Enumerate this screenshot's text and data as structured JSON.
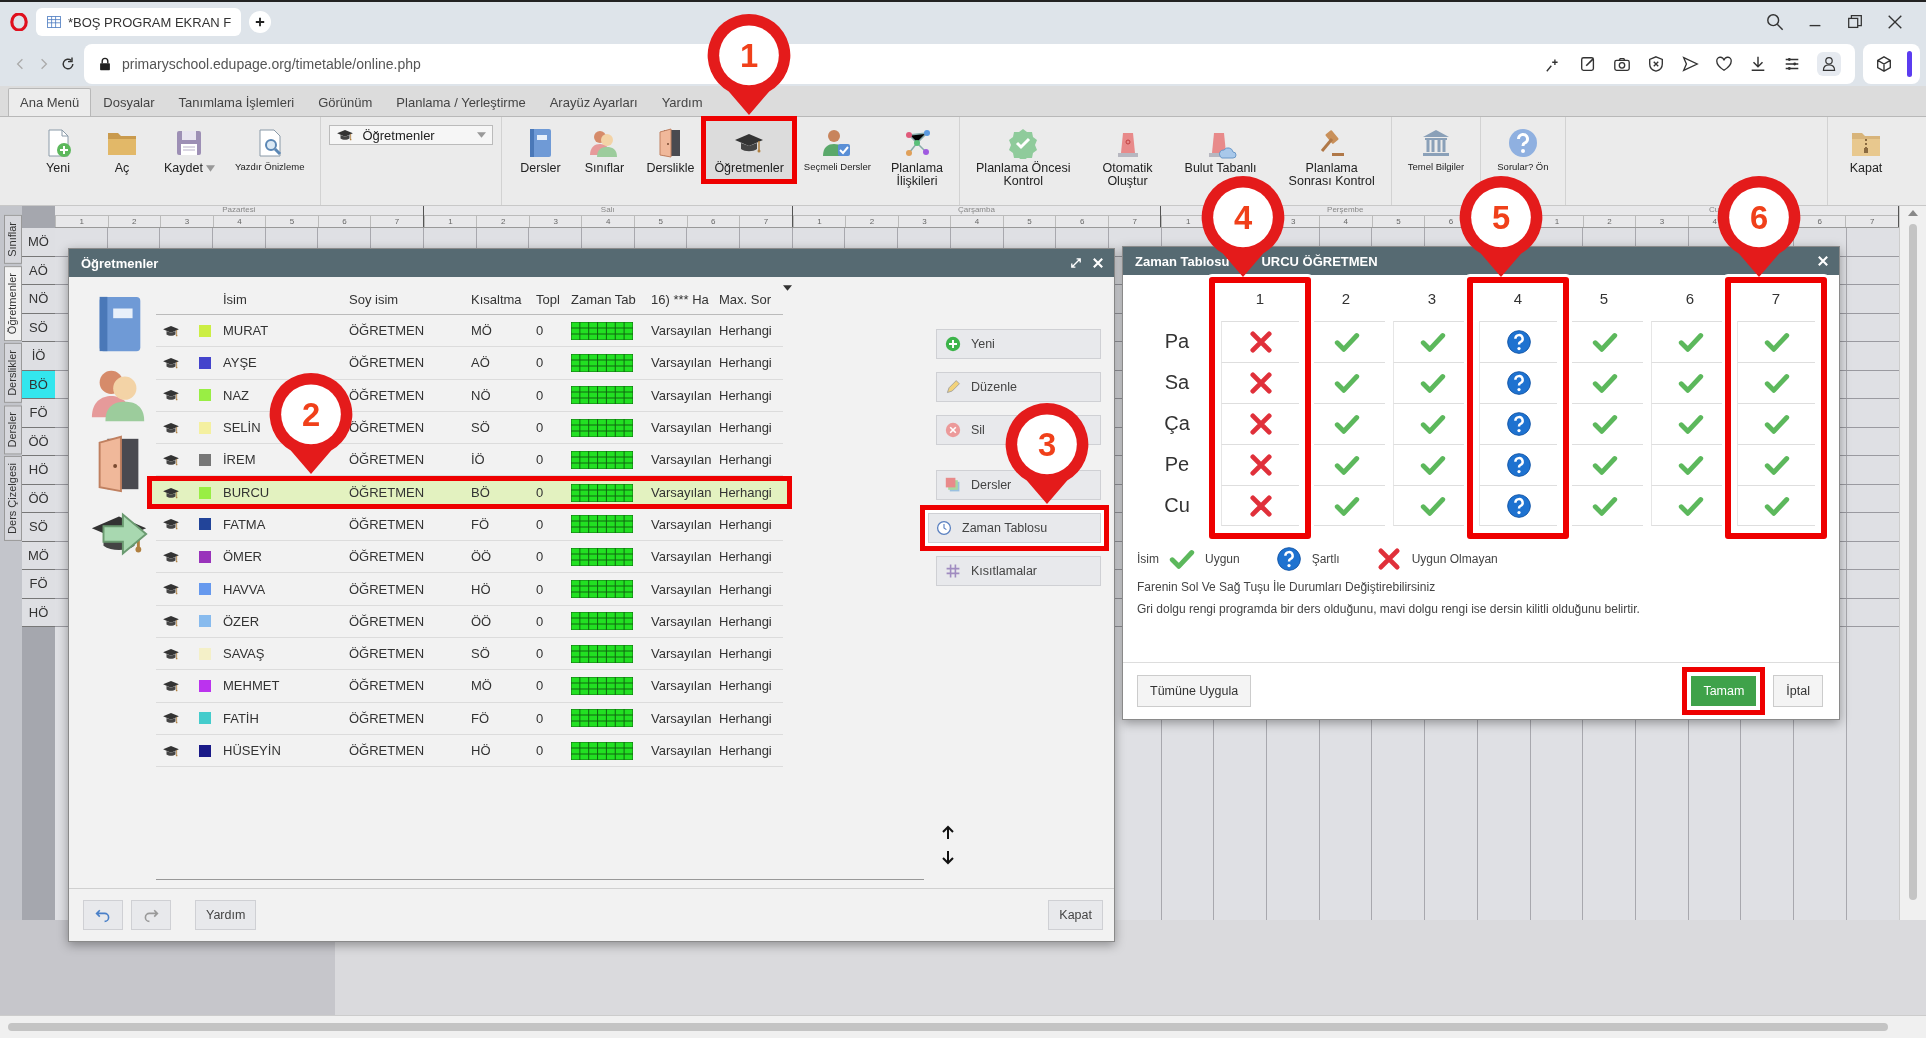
{
  "browser": {
    "tab_title": "*BOŞ PROGRAM EKRAN F",
    "url": "primaryschool.edupage.org/timetable/online.php"
  },
  "menu_tabs": [
    {
      "label": "Ana Menü",
      "selected": true
    },
    {
      "label": "Dosyalar",
      "selected": false
    },
    {
      "label": "Tanımlama İşlemleri",
      "selected": false
    },
    {
      "label": "Görünüm",
      "selected": false
    },
    {
      "label": "Planlama / Yerleştirme",
      "selected": false
    },
    {
      "label": "Arayüz Ayarları",
      "selected": false
    },
    {
      "label": "Yardım",
      "selected": false
    }
  ],
  "ribbon": {
    "groups": [
      {
        "items": [
          {
            "label": "Yeni",
            "kind": "large",
            "highlighted": false
          },
          {
            "label": "Aç",
            "kind": "large",
            "highlighted": false
          },
          {
            "label": "Kaydet",
            "kind": "menu",
            "highlighted": false
          },
          {
            "label": "Yazdır Önizleme",
            "kind": "small",
            "highlighted": false
          }
        ]
      },
      {
        "items": [
          {
            "label": "Öğretmenler",
            "kind": "dropdown",
            "highlighted": false
          }
        ]
      },
      {
        "items": [
          {
            "label": "Dersler",
            "kind": "large",
            "highlighted": false
          },
          {
            "label": "Sınıflar",
            "kind": "large",
            "highlighted": false
          },
          {
            "label": "Derslikle",
            "kind": "large",
            "highlighted": false
          },
          {
            "label": "Öğretmenler",
            "kind": "large",
            "highlighted": true,
            "callout": "1"
          },
          {
            "label": "Seçmeli Dersler",
            "kind": "small",
            "highlighted": false
          },
          {
            "label": "Planlama\nİlişkileri",
            "kind": "large",
            "highlighted": false
          }
        ]
      },
      {
        "items": [
          {
            "label": "Planlama Öncesi\nKontrol",
            "kind": "large",
            "highlighted": false
          },
          {
            "label": "Otomatik\nOluştur",
            "kind": "large",
            "highlighted": false
          },
          {
            "label": "Bulut Tabanlı",
            "kind": "large",
            "highlighted": false
          },
          {
            "label": "Planlama\nSonrası Kontrol",
            "kind": "large",
            "highlighted": false
          }
        ]
      },
      {
        "items": [
          {
            "label": "Temel Bilgiler",
            "kind": "small",
            "highlighted": false
          }
        ]
      },
      {
        "items": [
          {
            "label": "Sorular? Ön",
            "kind": "small",
            "highlighted": false
          }
        ]
      },
      {
        "items": [
          {
            "label": "Kapat",
            "kind": "large",
            "highlighted": false
          }
        ]
      }
    ]
  },
  "background_timetable": {
    "side_tabs": [
      {
        "label": "Sınıflar",
        "selected": false
      },
      {
        "label": "Öğretmenler",
        "selected": true
      },
      {
        "label": "Derslikler",
        "selected": false
      },
      {
        "label": "Dersler",
        "selected": false
      },
      {
        "label": "Ders Çizelgesi",
        "selected": false
      }
    ],
    "days": [
      {
        "label": "Pazartesi",
        "periods": [
          "1",
          "2",
          "3",
          "4",
          "5",
          "6",
          "7"
        ]
      },
      {
        "label": "Salı",
        "periods": [
          "1",
          "2",
          "3",
          "4",
          "5",
          "6",
          "7"
        ]
      },
      {
        "label": "Çarşamba",
        "periods": [
          "1",
          "2",
          "3",
          "4",
          "5",
          "6",
          "7"
        ]
      },
      {
        "label": "Perşembe",
        "periods": [
          "1",
          "3",
          "4",
          "5",
          "6"
        ]
      },
      {
        "label": "Cu",
        "periods": [
          "1",
          "2",
          "3",
          "4",
          "6",
          "7"
        ]
      }
    ],
    "rows": [
      {
        "label": "MÖ",
        "selected": false
      },
      {
        "label": "AÖ",
        "selected": false
      },
      {
        "label": "NÖ",
        "selected": false
      },
      {
        "label": "SÖ",
        "selected": false
      },
      {
        "label": "İÖ",
        "selected": false
      },
      {
        "label": "BÖ",
        "selected": true
      },
      {
        "label": "FÖ",
        "selected": false
      },
      {
        "label": "ÖÖ",
        "selected": false
      },
      {
        "label": "HÖ",
        "selected": false
      },
      {
        "label": "ÖÖ",
        "selected": false
      },
      {
        "label": "SÖ",
        "selected": false
      },
      {
        "label": "MÖ",
        "selected": false
      },
      {
        "label": "FÖ",
        "selected": false
      },
      {
        "label": "HÖ",
        "selected": false
      }
    ]
  },
  "teachers_dialog": {
    "title": "Öğretmenler",
    "nav": [
      {
        "selected": false
      },
      {
        "selected": false
      },
      {
        "selected": false
      },
      {
        "selected": true
      }
    ],
    "columns": [
      "İsim",
      "Soy isim",
      "Kısaltma",
      "Topl",
      "Zaman Tab",
      "16) *** Ha",
      "Max. Sor"
    ],
    "rows": [
      {
        "name": "MURAT",
        "surname": "ÖĞRETMEN",
        "abbr": "MÖ",
        "total": "0",
        "col_16": "Varsayılan",
        "max": "Herhangi",
        "color": "#ccee44",
        "selected": false,
        "highlighted": false
      },
      {
        "name": "AYŞE",
        "surname": "ÖĞRETMEN",
        "abbr": "AÖ",
        "total": "0",
        "col_16": "Varsayılan",
        "max": "Herhangi",
        "color": "#4444cc",
        "selected": false,
        "highlighted": false
      },
      {
        "name": "NAZ",
        "surname": "ÖĞRETMEN",
        "abbr": "NÖ",
        "total": "0",
        "col_16": "Varsayılan",
        "max": "Herhangi",
        "color": "#99ee44",
        "selected": false,
        "highlighted": false
      },
      {
        "name": "SELİN",
        "surname": "ÖĞRETMEN",
        "abbr": "SÖ",
        "total": "0",
        "col_16": "Varsayılan",
        "max": "Herhangi",
        "color": "#f4f0a0",
        "selected": false,
        "highlighted": false
      },
      {
        "name": "İREM",
        "surname": "ÖĞRETMEN",
        "abbr": "İÖ",
        "total": "0",
        "col_16": "Varsayılan",
        "max": "Herhangi",
        "color": "#777777",
        "selected": false,
        "highlighted": false
      },
      {
        "name": "BURCU",
        "surname": "ÖĞRETMEN",
        "abbr": "BÖ",
        "total": "0",
        "col_16": "Varsayılan",
        "max": "Herhangi",
        "color": "#99ee44",
        "selected": true,
        "highlighted": true,
        "callout": "2"
      },
      {
        "name": "FATMA",
        "surname": "ÖĞRETMEN",
        "abbr": "FÖ",
        "total": "0",
        "col_16": "Varsayılan",
        "max": "Herhangi",
        "color": "#224499",
        "selected": false,
        "highlighted": false
      },
      {
        "name": "ÖMER",
        "surname": "ÖĞRETMEN",
        "abbr": "ÖÖ",
        "total": "0",
        "col_16": "Varsayılan",
        "max": "Herhangi",
        "color": "#9933bb",
        "selected": false,
        "highlighted": false
      },
      {
        "name": "HAVVA",
        "surname": "ÖĞRETMEN",
        "abbr": "HÖ",
        "total": "0",
        "col_16": "Varsayılan",
        "max": "Herhangi",
        "color": "#6699ee",
        "selected": false,
        "highlighted": false
      },
      {
        "name": "ÖZER",
        "surname": "ÖĞRETMEN",
        "abbr": "ÖÖ",
        "total": "0",
        "col_16": "Varsayılan",
        "max": "Herhangi",
        "color": "#88bbee",
        "selected": false,
        "highlighted": false
      },
      {
        "name": "SAVAŞ",
        "surname": "ÖĞRETMEN",
        "abbr": "SÖ",
        "total": "0",
        "col_16": "Varsayılan",
        "max": "Herhangi",
        "color": "#f4f0c8",
        "selected": false,
        "highlighted": false
      },
      {
        "name": "MEHMET",
        "surname": "ÖĞRETMEN",
        "abbr": "MÖ",
        "total": "0",
        "col_16": "Varsayılan",
        "max": "Herhangi",
        "color": "#bb33ee",
        "selected": false,
        "highlighted": false
      },
      {
        "name": "FATİH",
        "surname": "ÖĞRETMEN",
        "abbr": "FÖ",
        "total": "0",
        "col_16": "Varsayılan",
        "max": "Herhangi",
        "color": "#44cccc",
        "selected": false,
        "highlighted": false
      },
      {
        "name": "HÜSEYİN",
        "surname": "ÖĞRETMEN",
        "abbr": "HÖ",
        "total": "0",
        "col_16": "Varsayılan",
        "max": "Herhangi",
        "color": "#1a1a88",
        "selected": false,
        "highlighted": false
      }
    ],
    "actions": [
      {
        "label": "Yeni",
        "highlighted": false
      },
      {
        "label": "Düzenle",
        "highlighted": false
      },
      {
        "label": "Sil",
        "highlighted": false
      },
      {
        "label": "Dersler",
        "highlighted": false
      },
      {
        "label": "Zaman Tablosu",
        "highlighted": true,
        "callout": "3"
      },
      {
        "label": "Kısıtlamalar",
        "highlighted": false
      }
    ],
    "footer": {
      "help": "Yardım",
      "close": "Kapat"
    }
  },
  "timetable_dialog": {
    "title_parts": [
      "Zaman Tablosu",
      "URCU ÖĞRETMEN"
    ],
    "days": [
      "Pa",
      "Sa",
      "Ça",
      "Pe",
      "Cu"
    ],
    "periods": [
      {
        "label": "1",
        "highlighted": true,
        "callout": "4",
        "cells": [
          {
            "kind": "unavailable"
          },
          {
            "kind": "unavailable"
          },
          {
            "kind": "unavailable"
          },
          {
            "kind": "unavailable"
          },
          {
            "kind": "unavailable"
          }
        ]
      },
      {
        "label": "2",
        "highlighted": false,
        "cells": [
          {
            "kind": "available"
          },
          {
            "kind": "available"
          },
          {
            "kind": "available"
          },
          {
            "kind": "available"
          },
          {
            "kind": "available"
          }
        ]
      },
      {
        "label": "3",
        "highlighted": false,
        "cells": [
          {
            "kind": "available"
          },
          {
            "kind": "available"
          },
          {
            "kind": "available"
          },
          {
            "kind": "available"
          },
          {
            "kind": "available"
          }
        ]
      },
      {
        "label": "4",
        "highlighted": true,
        "callout": "5",
        "cells": [
          {
            "kind": "conditional"
          },
          {
            "kind": "conditional"
          },
          {
            "kind": "conditional"
          },
          {
            "kind": "conditional"
          },
          {
            "kind": "conditional"
          }
        ]
      },
      {
        "label": "5",
        "highlighted": false,
        "cells": [
          {
            "kind": "available"
          },
          {
            "kind": "available"
          },
          {
            "kind": "available"
          },
          {
            "kind": "available"
          },
          {
            "kind": "available"
          }
        ]
      },
      {
        "label": "6",
        "highlighted": false,
        "cells": [
          {
            "kind": "available"
          },
          {
            "kind": "available"
          },
          {
            "kind": "available"
          },
          {
            "kind": "available"
          },
          {
            "kind": "available"
          }
        ]
      },
      {
        "label": "7",
        "highlighted": true,
        "callout": "6",
        "cells": [
          {
            "kind": "available"
          },
          {
            "kind": "available"
          },
          {
            "kind": "available"
          },
          {
            "kind": "available"
          },
          {
            "kind": "available"
          }
        ]
      }
    ],
    "legend": [
      {
        "kind": "caption",
        "label": "İsim"
      },
      {
        "kind": "available",
        "label": "Uygun"
      },
      {
        "kind": "conditional",
        "label": "Şartlı"
      },
      {
        "kind": "unavailable",
        "label": "Uygun Olmayan"
      }
    ],
    "notes": [
      "Farenin Sol Ve Sağ Tuşu İle Durumları Değiştirebilirsiniz",
      "Gri dolgu rengi programda bir ders olduğunu, mavi dolgu rengi ise dersin kilitli olduğunu belirtir."
    ],
    "buttons": [
      {
        "label": "Tümüne Uygula",
        "kind": "secondary",
        "highlighted": false
      },
      {
        "label": "Tamam",
        "kind": "primary",
        "highlighted": true
      },
      {
        "label": "İptal",
        "kind": "secondary",
        "highlighted": false
      }
    ]
  }
}
